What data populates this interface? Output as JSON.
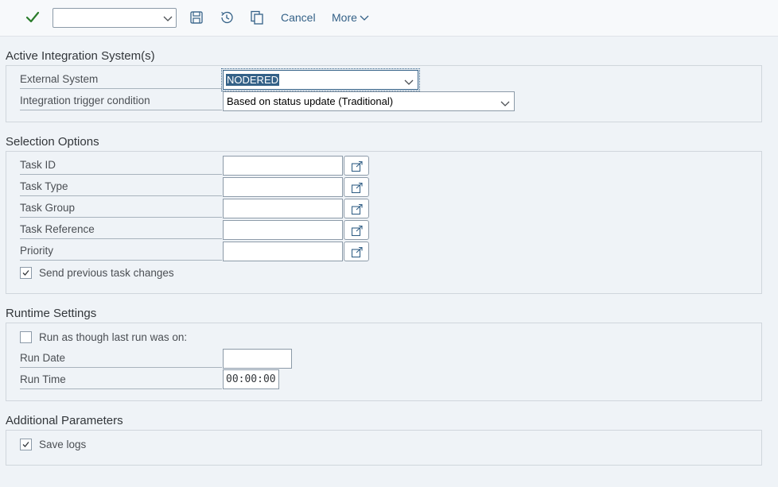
{
  "toolbar": {
    "variant_value": "",
    "cancel_label": "Cancel",
    "more_label": "More",
    "icons": [
      "checkmark-icon",
      "save-icon",
      "history-icon",
      "copy-icon",
      "chevron-down-icon"
    ],
    "accent_color": "#2b7c2b",
    "link_color": "#346187"
  },
  "integration": {
    "title": "Active Integration System(s)",
    "external_system_label": "External System",
    "external_system_value": "NODERED",
    "trigger_label": "Integration trigger condition",
    "trigger_value": "Based on status update (Traditional)"
  },
  "selection": {
    "title": "Selection Options",
    "fields": [
      {
        "label": "Task ID",
        "value": ""
      },
      {
        "label": "Task Type",
        "value": ""
      },
      {
        "label": "Task Group",
        "value": ""
      },
      {
        "label": "Task Reference",
        "value": ""
      },
      {
        "label": "Priority",
        "value": ""
      }
    ],
    "send_previous_label": "Send previous task changes",
    "send_previous_checked": true
  },
  "runtime": {
    "title": "Runtime Settings",
    "run_as_label": "Run as though last run was on:",
    "run_as_checked": false,
    "run_date_label": "Run Date",
    "run_date_value": "",
    "run_time_label": "Run Time",
    "run_time_value": "00:00:00"
  },
  "additional": {
    "title": "Additional Parameters",
    "save_logs_label": "Save logs",
    "save_logs_checked": true
  }
}
